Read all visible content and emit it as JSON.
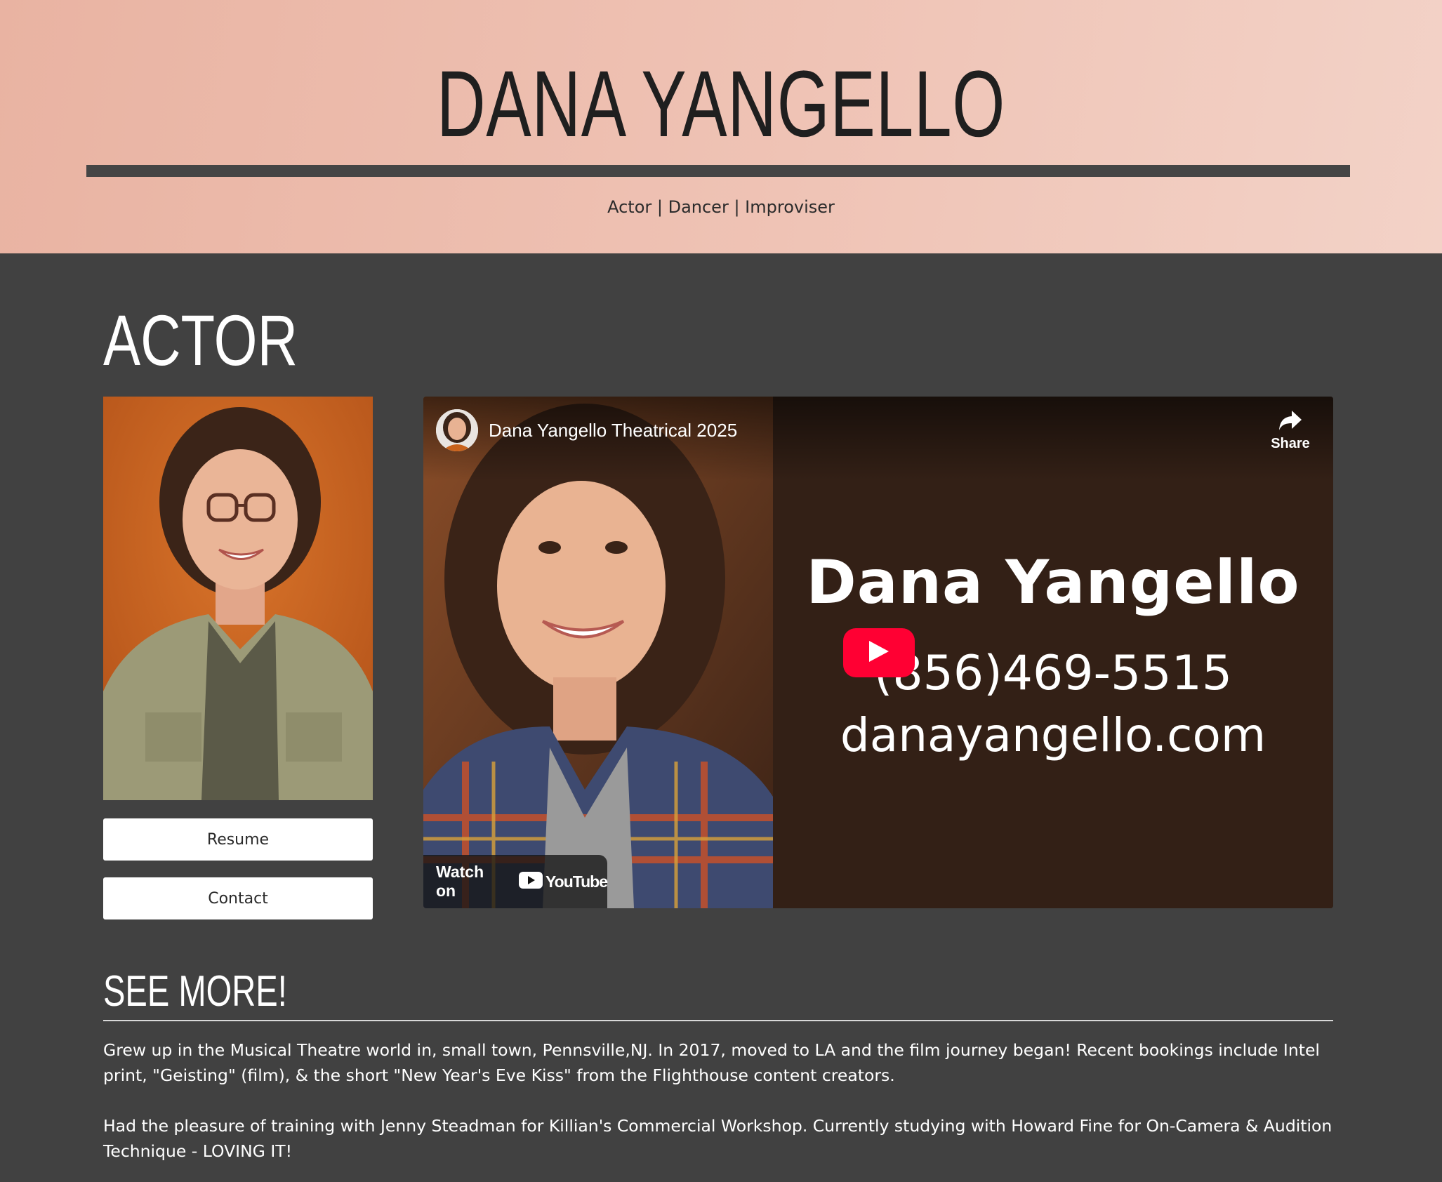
{
  "header": {
    "site_title": "DANA YANGELLO",
    "tagline": "Actor | Dancer | Improviser"
  },
  "actor_section": {
    "title": "ACTOR",
    "resume_button": "Resume",
    "contact_button": "Contact"
  },
  "video": {
    "title": "Dana Yangello Theatrical 2025",
    "share_label": "Share",
    "card_name": "Dana Yangello",
    "card_phone": "(856)469-5515",
    "card_site": "danayangello.com",
    "watch_on_label": "Watch on",
    "youtube_label": "YouTube"
  },
  "see_more": {
    "title": "SEE MORE!",
    "paragraph_1": "Grew up in the Musical Theatre world in, small town, Pennsville,NJ. In 2017, moved to LA and the film journey began! Recent bookings include Intel print, \"Geisting\" (film), & the short \"New Year's Eve Kiss\" from the Flighthouse content creators.",
    "paragraph_2": "Had the pleasure of training with Jenny Steadman for Killian's Commercial Workshop. Currently studying with Howard Fine for On-Camera & Audition Technique - LOVING IT!"
  },
  "colors": {
    "header_bg": "#efc3b5",
    "page_bg": "#414141",
    "play_button": "#ff0033"
  },
  "icons": [
    "share-icon",
    "play-icon",
    "youtube-logo-icon"
  ]
}
